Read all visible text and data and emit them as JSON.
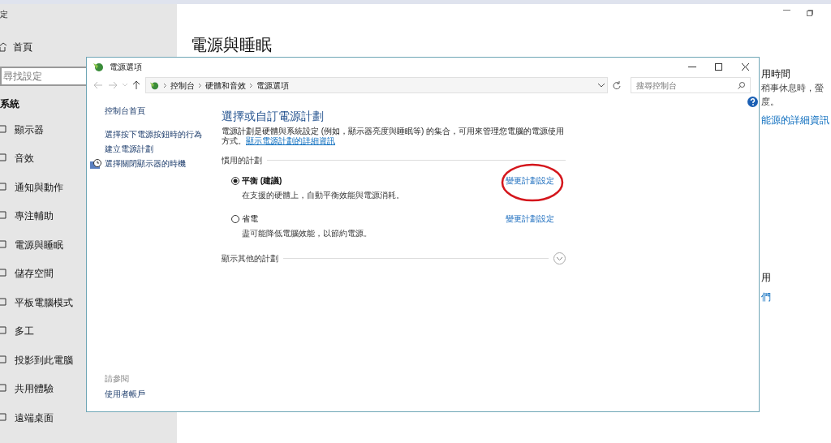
{
  "settings_window": {
    "title": "定",
    "home": "首頁",
    "search": {
      "placeholder": "尋找設定"
    },
    "section": "系統",
    "items": [
      {
        "label": "顯示器"
      },
      {
        "label": "音效"
      },
      {
        "label": "通知與動作"
      },
      {
        "label": "專注輔助"
      },
      {
        "label": "電源與睡眠"
      },
      {
        "label": "儲存空間"
      },
      {
        "label": "平板電腦模式"
      },
      {
        "label": "多工"
      },
      {
        "label": "投影到此電腦"
      },
      {
        "label": "共用體驗"
      },
      {
        "label": "遠端桌面"
      }
    ],
    "page_title": "電源與睡眠",
    "side_texts": [
      {
        "text": "用時間",
        "kind": "heading"
      },
      {
        "text": "稍事休息時，螢",
        "kind": "body"
      },
      {
        "text": "度。",
        "kind": "body"
      },
      {
        "text": "能源的詳細資訊",
        "kind": "link"
      },
      {
        "text": "用",
        "kind": "heading"
      },
      {
        "text": "們",
        "kind": "link"
      }
    ]
  },
  "dialog": {
    "title": "電源選項",
    "breadcrumb": [
      "控制台",
      "硬體和音效",
      "電源選項"
    ],
    "search": {
      "placeholder": "搜尋控制台"
    },
    "home_link": "控制台首頁",
    "left_links": [
      {
        "label": "選擇按下電源按鈕時的行為",
        "kind": "link"
      },
      {
        "label": "建立電源計劃",
        "kind": "link"
      },
      {
        "label": "選擇關閉顯示器的時機",
        "kind": "icon_link"
      }
    ],
    "see_also": {
      "heading": "請參閱",
      "links": [
        "使用者帳戶"
      ]
    },
    "heading": "選擇或自訂電源計劃",
    "description": "電源計劃是硬體與系統設定 (例如，顯示器亮度與睡眠等) 的集合，可用來管理您電腦的電源使用方式。",
    "description_link": "顯示電源計劃的詳細資訊",
    "preferred_section": "慣用的計劃",
    "plans": [
      {
        "name": "平衡 (建議)",
        "selected": true,
        "description": "在支援的硬體上，自動平衡效能與電源消耗。",
        "link": "變更計劃設定"
      },
      {
        "name": "省電",
        "selected": false,
        "description": "盡可能降低電腦效能，以節約電源。",
        "link": "變更計劃設定"
      }
    ],
    "more_plans": {
      "label": "顯示其他的計劃",
      "expanded": false
    }
  }
}
